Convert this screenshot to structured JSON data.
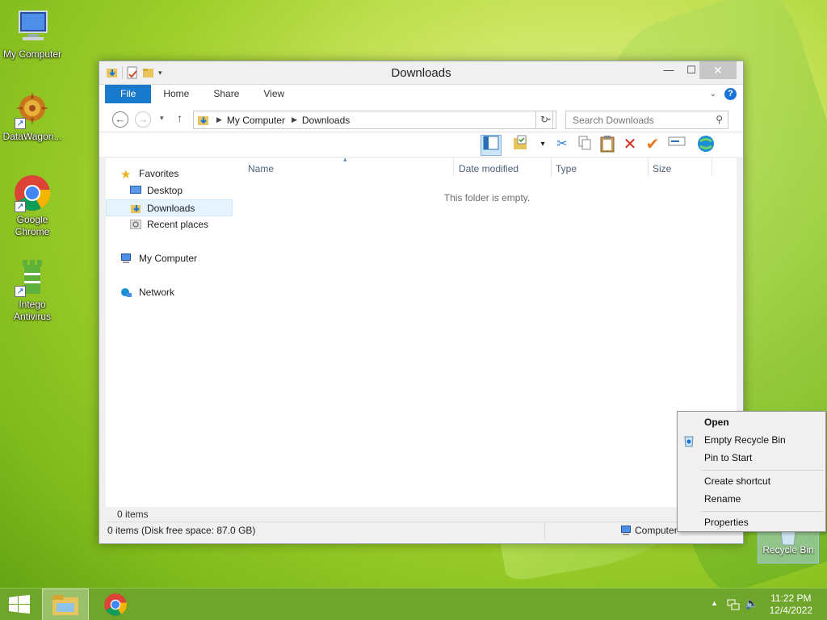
{
  "desktop": {
    "icons": [
      {
        "label": "My Computer"
      },
      {
        "label": "DataWagon..."
      },
      {
        "label": "Google Chrome"
      },
      {
        "label": "Intego Antivirus"
      }
    ],
    "recycle_bin": "Recycle Bin"
  },
  "window": {
    "title": "Downloads",
    "ribbon_tabs": [
      "File",
      "Home",
      "Share",
      "View"
    ],
    "address": {
      "crumbs": [
        "My Computer",
        "Downloads"
      ]
    },
    "search_placeholder": "Search Downloads",
    "navpane": {
      "favorites": "Favorites",
      "desktop": "Desktop",
      "downloads": "Downloads",
      "recent": "Recent places",
      "my_computer": "My Computer",
      "network": "Network"
    },
    "columns": [
      "Name",
      "Date modified",
      "Type",
      "Size"
    ],
    "empty_message": "This folder is empty.",
    "item_count": "0 items",
    "status_left": "0 items (Disk free space: 87.0 GB)",
    "status_right": "Computer"
  },
  "context_menu": {
    "items": [
      "Open",
      "Empty Recycle Bin",
      "Pin to Start",
      "Create shortcut",
      "Rename",
      "Properties"
    ]
  },
  "taskbar": {
    "time": "11:22 PM",
    "date": "12/4/2022"
  },
  "colors": {
    "accent": "#1979ca",
    "taskbar": "#6fa52a"
  }
}
